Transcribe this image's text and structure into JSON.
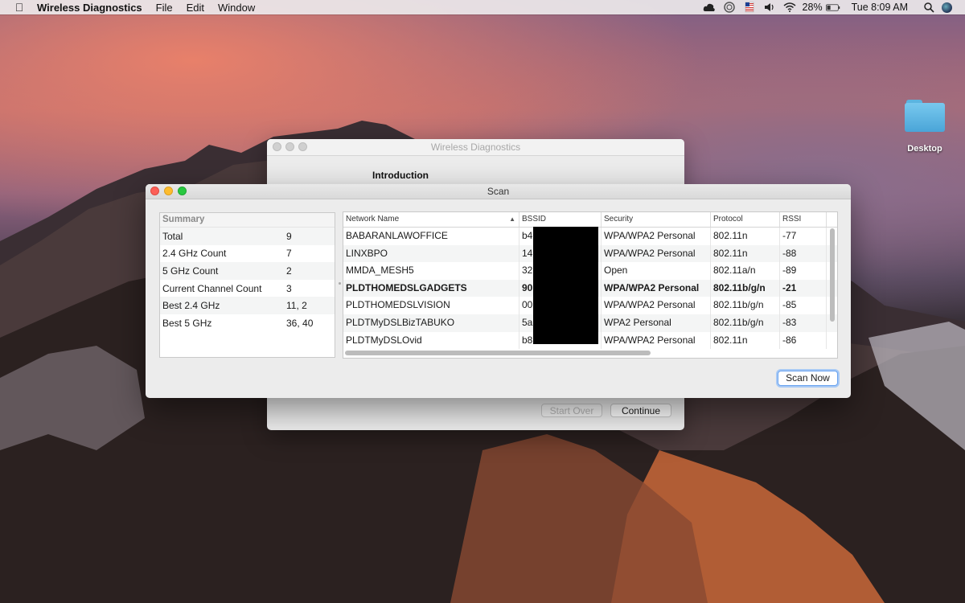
{
  "menubar": {
    "apple_icon": "apple-logo-icon",
    "app_name": "Wireless Diagnostics",
    "menus": [
      "File",
      "Edit",
      "Window"
    ],
    "battery_percent": "28%",
    "clock": "Tue 8:09 AM",
    "status_icons": [
      "creative-cloud-icon",
      "activity-icon",
      "flag-icon",
      "volume-icon",
      "wifi-icon",
      "battery-icon",
      "search-icon",
      "siri-icon"
    ]
  },
  "desktop": {
    "folder_label": "Desktop"
  },
  "back_window": {
    "title": "Wireless Diagnostics",
    "heading": "Introduction",
    "start_over_label": "Start Over",
    "continue_label": "Continue"
  },
  "scan_window": {
    "title": "Scan",
    "summary": {
      "header": "Summary",
      "rows": [
        {
          "label": "Total",
          "value": "9"
        },
        {
          "label": "2.4 GHz Count",
          "value": "7"
        },
        {
          "label": "5 GHz Count",
          "value": "2"
        },
        {
          "label": "Current Channel Count",
          "value": "3"
        },
        {
          "label": "Best 2.4 GHz",
          "value": "11, 2"
        },
        {
          "label": "Best 5 GHz",
          "value": "36, 40"
        }
      ]
    },
    "networks": {
      "columns": [
        "Network Name",
        "BSSID",
        "Security",
        "Protocol",
        "RSSI"
      ],
      "rows": [
        {
          "name": "BABARANLAWOFFICE",
          "bssid": "b4",
          "security": "WPA/WPA2 Personal",
          "protocol": "802.11n",
          "rssi": "-77"
        },
        {
          "name": "LINXBPO",
          "bssid": "14:",
          "security": "WPA/WPA2 Personal",
          "protocol": "802.11n",
          "rssi": "-88"
        },
        {
          "name": "MMDA_MESH5",
          "bssid": "32",
          "security": "Open",
          "protocol": "802.11a/n",
          "rssi": "-89"
        },
        {
          "name": "PLDTHOMEDSLGADGETS",
          "bssid": "90",
          "security": "WPA/WPA2 Personal",
          "protocol": "802.11b/g/n",
          "rssi": "-21"
        },
        {
          "name": "PLDTHOMEDSLVISION",
          "bssid": "00",
          "security": "WPA/WPA2 Personal",
          "protocol": "802.11b/g/n",
          "rssi": "-85"
        },
        {
          "name": "PLDTMyDSLBizTABUKO",
          "bssid": "5a:",
          "security": "WPA2 Personal",
          "protocol": "802.11b/g/n",
          "rssi": "-83"
        },
        {
          "name": "PLDTMyDSLOvid",
          "bssid": "b8",
          "security": "WPA/WPA2 Personal",
          "protocol": "802.11n",
          "rssi": "-86"
        }
      ]
    },
    "scan_now_label": "Scan Now"
  }
}
